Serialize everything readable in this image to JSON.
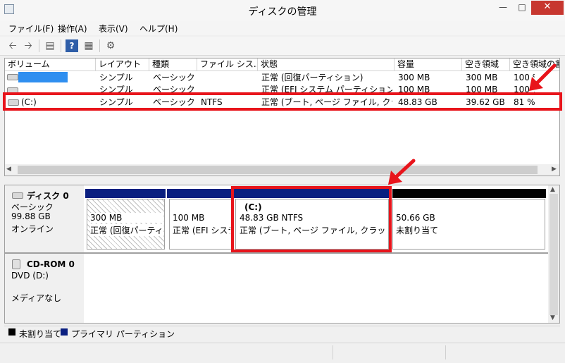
{
  "window": {
    "title": "ディスクの管理"
  },
  "menu": [
    "ファイル(F)",
    "操作(A)",
    "表示(V)",
    "ヘルプ(H)"
  ],
  "volume_table": {
    "columns": [
      "ボリューム",
      "レイアウト",
      "種類",
      "ファイル シス...",
      "状態",
      "容量",
      "空き領域",
      "空き領域の割"
    ],
    "rows": [
      {
        "volume": "",
        "layout": "シンプル",
        "type": "ベーシック",
        "fs": "",
        "status": "正常 (回復パーティション)",
        "capacity": "300 MB",
        "free": "300 MB",
        "pct": "100 %"
      },
      {
        "volume": "",
        "layout": "シンプル",
        "type": "ベーシック",
        "fs": "",
        "status": "正常 (EFI システム パーティション)",
        "capacity": "100 MB",
        "free": "100 MB",
        "pct": "100 %"
      },
      {
        "volume": "(C:)",
        "layout": "シンプル",
        "type": "ベーシック",
        "fs": "NTFS",
        "status": "正常 (ブート, ページ ファイル, クラッ...",
        "capacity": "48.83 GB",
        "free": "39.62 GB",
        "pct": "81 %"
      }
    ]
  },
  "disk0": {
    "name": "ディスク 0",
    "type": "ベーシック",
    "size": "99.88 GB",
    "state": "オンライン",
    "partitions": [
      {
        "size": "300 MB",
        "status": "正常 (回復パーティション)"
      },
      {
        "size": "100 MB",
        "status": "正常 (EFI システム パーティション)"
      },
      {
        "label": "(C:)",
        "size": "48.83 GB NTFS",
        "status": "正常 (ブート, ページ ファイル, クラッシュ ダンプ, プライマリ パーティション)"
      },
      {
        "size": "50.66 GB",
        "status": "未割り当て"
      }
    ]
  },
  "cdrom0": {
    "name": "CD-ROM 0",
    "type": "DVD (D:)",
    "state": "メディアなし"
  },
  "legend": {
    "unallocated": "未割り当て",
    "primary": "プライマリ パーティション"
  },
  "colors": {
    "primary": "#0a1f80",
    "unallocated": "#000000",
    "annotation": "#e8141b",
    "redacted": "#2f8ff0"
  }
}
